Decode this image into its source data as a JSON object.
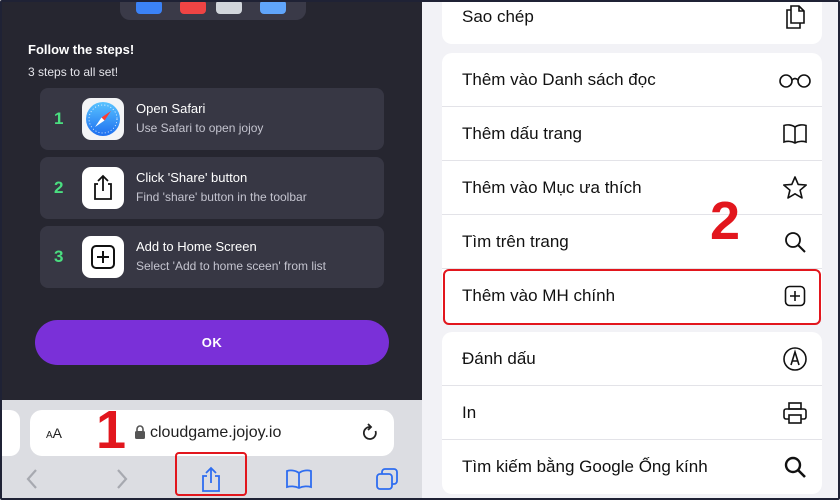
{
  "left_panel": {
    "heading": "Follow the steps!",
    "subheading": "3 steps to all set!",
    "steps": [
      {
        "number": "1",
        "title": "Open Safari",
        "desc": "Use Safari to open jojoy",
        "icon": "safari-icon"
      },
      {
        "number": "2",
        "title": "Click 'Share' button",
        "desc": "Find 'share' button in the toolbar",
        "icon": "share-icon"
      },
      {
        "number": "3",
        "title": "Add to Home Screen",
        "desc": "Select 'Add to home sceen' from list",
        "icon": "add-square-icon"
      }
    ],
    "ok_label": "OK",
    "accent_color": "#7a30d8",
    "step_number_color": "#4ade80"
  },
  "browser": {
    "text_size_label_small": "A",
    "text_size_label_large": "A",
    "url": "cloudgame.jojoy.io",
    "toolbar_icons": [
      "back-icon",
      "forward-icon",
      "share-icon",
      "bookmarks-icon",
      "tabs-icon"
    ]
  },
  "annotations": {
    "marker_1": "1",
    "marker_2": "2",
    "highlight_color": "#e2161d"
  },
  "share_menu": {
    "top_item": {
      "label": "Sao chép",
      "icon": "copy-icon"
    },
    "group1": [
      {
        "label": "Thêm vào Danh sách đọc",
        "icon": "glasses-icon"
      },
      {
        "label": "Thêm dấu trang",
        "icon": "book-icon"
      },
      {
        "label": "Thêm vào Mục ưa thích",
        "icon": "star-icon"
      },
      {
        "label": "Tìm trên trang",
        "icon": "search-icon"
      },
      {
        "label": "Thêm vào MH chính",
        "icon": "add-square-icon"
      }
    ],
    "group2": [
      {
        "label": "Đánh dấu",
        "icon": "markup-icon"
      },
      {
        "label": "In",
        "icon": "printer-icon"
      },
      {
        "label": "Tìm kiếm bằng Google Ống kính",
        "icon": "search-icon"
      }
    ]
  }
}
